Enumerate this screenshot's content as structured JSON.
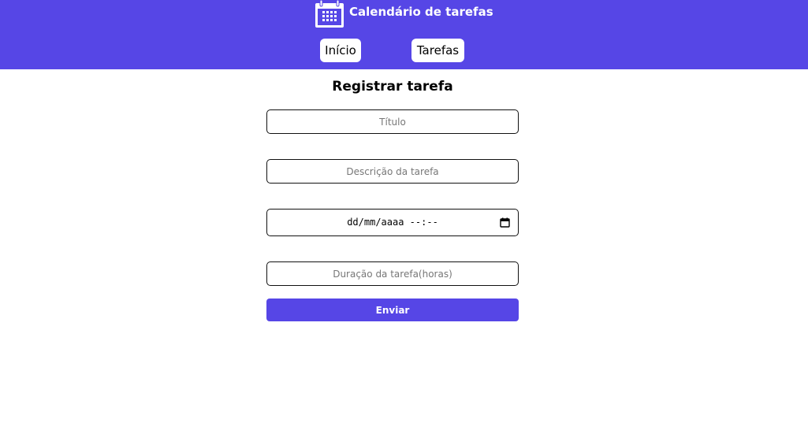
{
  "header": {
    "app_title": "Calendário de tarefas",
    "icon": "calendar-icon",
    "background_color": "#5646e6"
  },
  "nav": {
    "items": [
      {
        "label": "Início"
      },
      {
        "label": "Tarefas"
      }
    ]
  },
  "form": {
    "title": "Registrar tarefa",
    "titulo_placeholder": "Título",
    "descricao_placeholder": "Descrição da tarefa",
    "datetime_display": "dd/mm/aaaa --:--",
    "datetime_icon": "calendar-icon",
    "duracao_placeholder": "Duração da tarefa(horas)",
    "submit_label": "Enviar",
    "accent_color": "#5646e6"
  }
}
